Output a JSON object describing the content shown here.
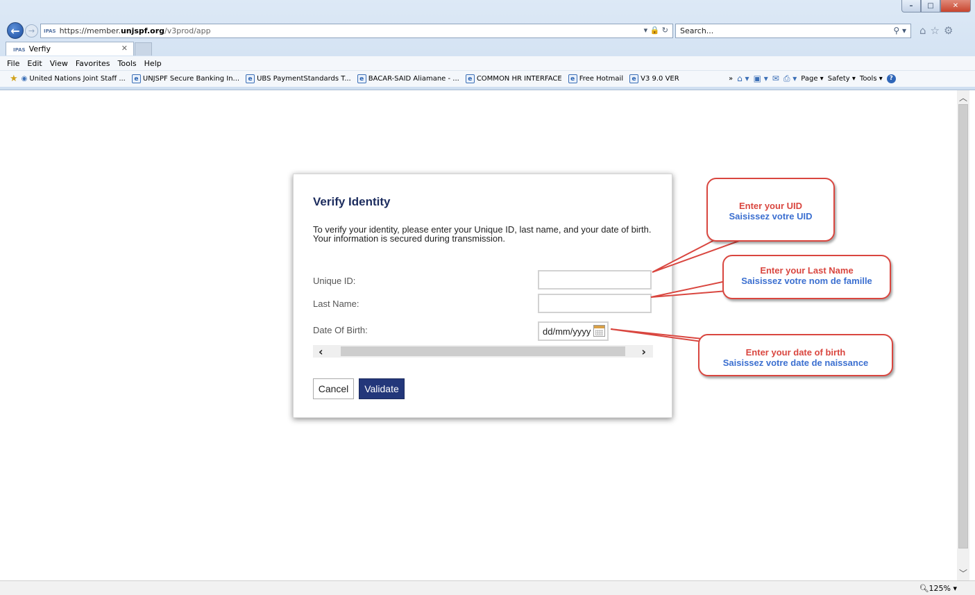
{
  "browser": {
    "url_prefix": "https://member.",
    "url_host": "unjspf.org",
    "url_path": "/v3prod/app",
    "url_badge": "IPAS",
    "search_placeholder": "Search...",
    "tab_title": "Verfiy",
    "menu": [
      "File",
      "Edit",
      "View",
      "Favorites",
      "Tools",
      "Help"
    ],
    "favorites": [
      "United Nations Joint Staff ...",
      "UNJSPF Secure Banking In...",
      "UBS PaymentStandards T...",
      "BACAR-SAID Aliamane - ...",
      "COMMON HR INTERFACE",
      "Free Hotmail",
      "V3 9.0 VER"
    ],
    "command_bar": {
      "page": "Page ▾",
      "safety": "Safety ▾",
      "tools": "Tools ▾"
    },
    "zoom": "125%"
  },
  "form": {
    "title": "Verify Identity",
    "description": "To verify your identity, please enter your Unique ID, last name, and your date of birth. Your information is secured during transmission.",
    "unique_id_label": "Unique ID:",
    "last_name_label": "Last Name:",
    "dob_label": "Date Of Birth:",
    "unique_id_value": "",
    "last_name_value": "",
    "dob_value": "dd/mm/yyyy",
    "cancel_label": "Cancel",
    "validate_label": "Validate"
  },
  "callouts": {
    "uid_en": "Enter your UID",
    "uid_fr": "Saisissez votre UID",
    "lastname_en": "Enter your Last Name",
    "lastname_fr": "Saisissez votre nom de famille",
    "dob_en": "Enter your date of birth",
    "dob_fr": "Saisissez votre date de naissance"
  },
  "colors": {
    "callout_border": "#d9463f",
    "callout_en_text": "#d9463f",
    "callout_fr_text": "#3b6fd0",
    "title": "#1c2c5e",
    "validate_button": "#23377a"
  }
}
